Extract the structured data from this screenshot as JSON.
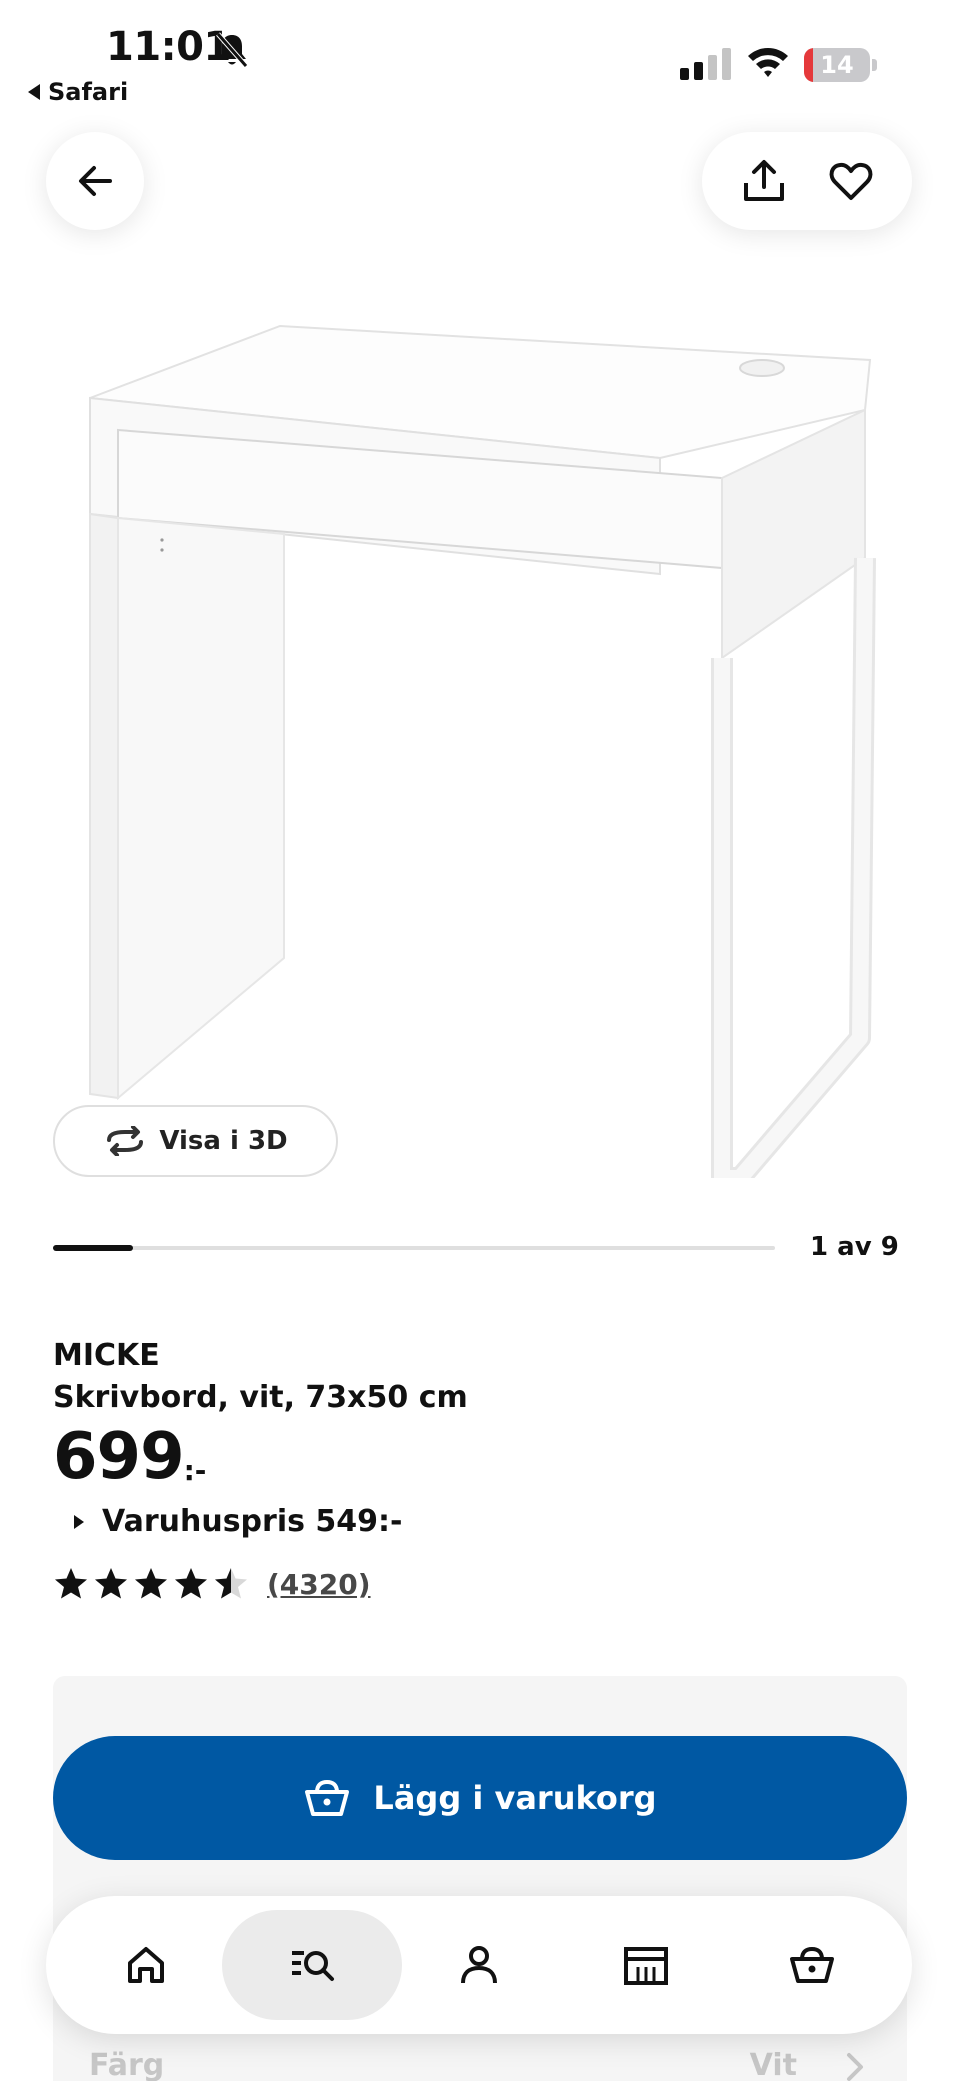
{
  "status_bar": {
    "time": "11:01",
    "back_app": "Safari",
    "battery_level": "14",
    "battery_fraction": 0.14,
    "signal_bars_active": 2
  },
  "header": {
    "back_icon": "arrow-left-icon",
    "share_icon": "share-icon",
    "favorite_icon": "heart-icon"
  },
  "gallery": {
    "view_3d_label": "Visa i 3D",
    "page_counter": "1 av 9",
    "current_image": 1,
    "total_images": 9
  },
  "product": {
    "name": "MICKE",
    "description": "Skrivbord, vit, 73x50 cm",
    "price": "699",
    "price_suffix": ":-",
    "store_price": "Varuhuspris 549:-",
    "rating": 4.5,
    "rating_max": 5,
    "review_count": "(4320)"
  },
  "cart": {
    "add_label": "Lägg i varukorg",
    "accent_color": "#0058a3"
  },
  "options": {
    "color_label": "Färg",
    "color_value": "Vit"
  },
  "bottom_nav": [
    {
      "name": "home",
      "icon": "home-icon",
      "active": false
    },
    {
      "name": "search",
      "icon": "search-icon",
      "active": true
    },
    {
      "name": "profile",
      "icon": "person-icon",
      "active": false
    },
    {
      "name": "store",
      "icon": "store-icon",
      "active": false
    },
    {
      "name": "cart",
      "icon": "basket-icon",
      "active": false
    }
  ]
}
